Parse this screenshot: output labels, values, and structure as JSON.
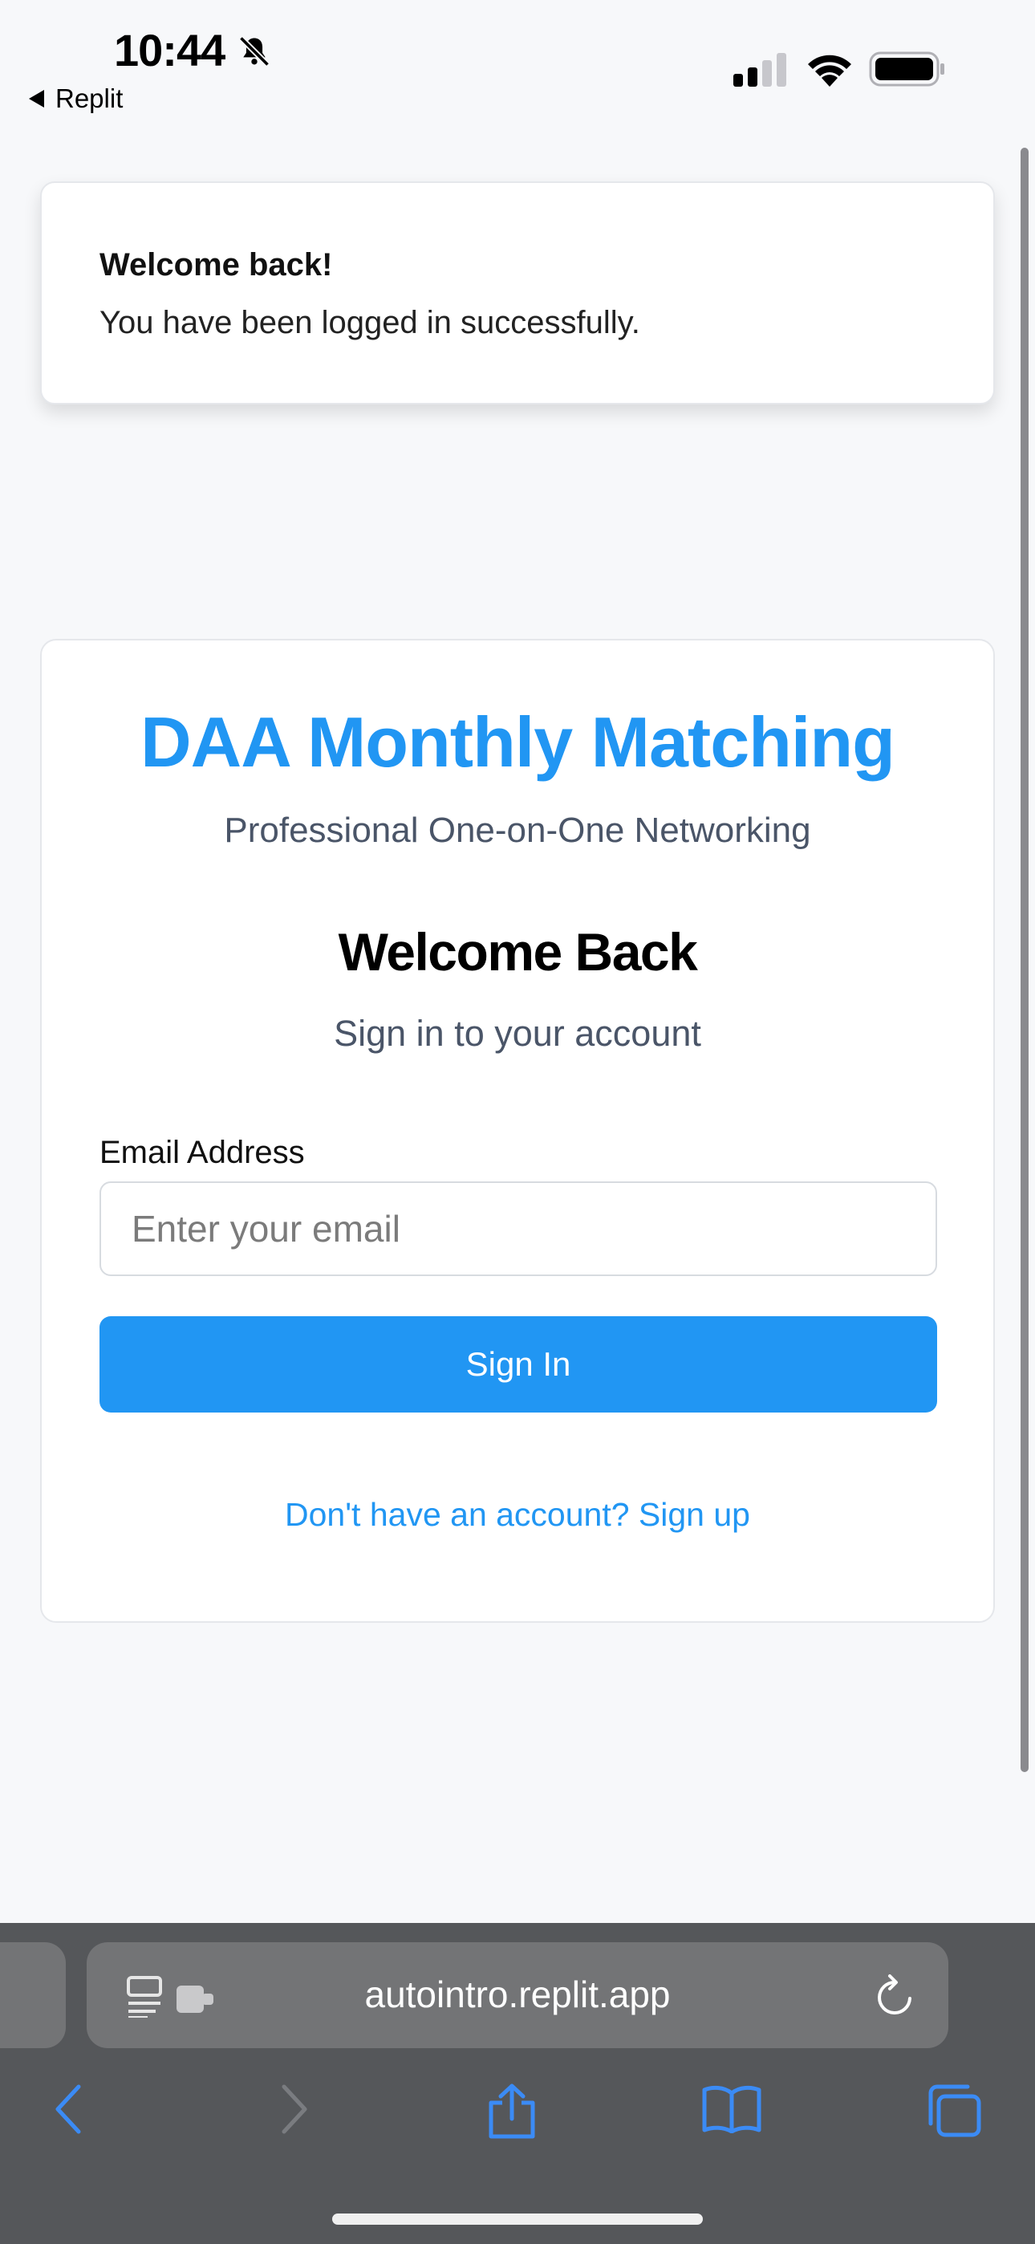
{
  "status_bar": {
    "time": "10:44",
    "back_app_label": "Replit",
    "icons": [
      "bell-slash-icon",
      "cellular-signal-icon",
      "wifi-icon",
      "battery-icon"
    ]
  },
  "toast": {
    "title": "Welcome back!",
    "description": "You have been logged in successfully."
  },
  "login": {
    "app_title": "DAA Monthly Matching",
    "app_subtitle": "Professional One-on-One Networking",
    "heading": "Welcome Back",
    "subheading": "Sign in to your account",
    "email_label": "Email Address",
    "email_placeholder": "Enter your email",
    "email_value": "",
    "sign_in_label": "Sign In",
    "signup_link": "Don't have an account? Sign up"
  },
  "browser": {
    "url": "autointro.replit.app",
    "icons": [
      "reader-mode-icon",
      "extension-icon",
      "reload-icon",
      "back-icon",
      "forward-icon",
      "share-icon",
      "bookmarks-icon",
      "tabs-icon"
    ]
  },
  "colors": {
    "accent": "#2196f3",
    "page_background": "#f7f8fa",
    "browser_chrome": "#55575a",
    "browser_icon": "#3b8bf5"
  }
}
